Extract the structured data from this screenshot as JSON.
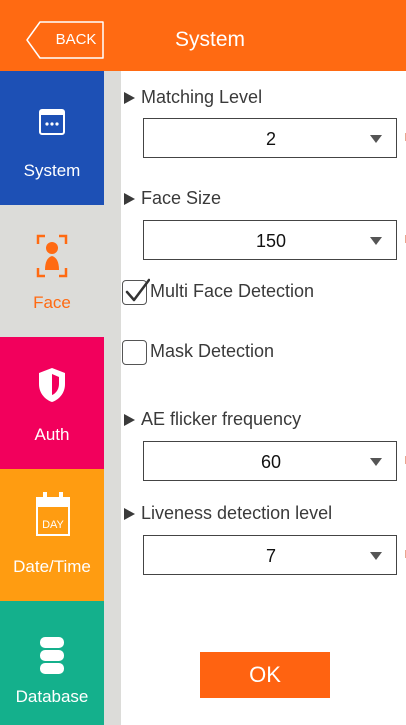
{
  "header": {
    "back_label": "BACK",
    "title": "System",
    "color": "#ff6a12"
  },
  "sidebar": {
    "items": [
      {
        "label": "System",
        "icon": "window-icon",
        "color": "#1d50b5",
        "active": false
      },
      {
        "label": "Face",
        "icon": "face-scan-icon",
        "color": "#dcdcd9",
        "active": true
      },
      {
        "label": "Auth",
        "icon": "shield-icon",
        "color": "#f2005c",
        "active": false
      },
      {
        "label": "Date/Time",
        "icon": "calendar-icon",
        "color": "#ff9c11",
        "active": false,
        "icon_text": "DAY"
      },
      {
        "label": "Database",
        "icon": "database-icon",
        "color": "#14b08c",
        "active": false
      }
    ]
  },
  "settings": {
    "matching_level": {
      "label": "Matching Level",
      "value": "2"
    },
    "face_size": {
      "label": "Face Size",
      "value": "150"
    },
    "multi_face": {
      "label": "Multi Face Detection",
      "checked": true
    },
    "mask": {
      "label": "Mask Detection",
      "checked": false
    },
    "ae_flicker": {
      "label": "AE flicker frequency",
      "value": "60"
    },
    "liveness": {
      "label": "Liveness detection level",
      "value": "7"
    }
  },
  "footer": {
    "ok_label": "OK",
    "color": "#ff6311"
  }
}
